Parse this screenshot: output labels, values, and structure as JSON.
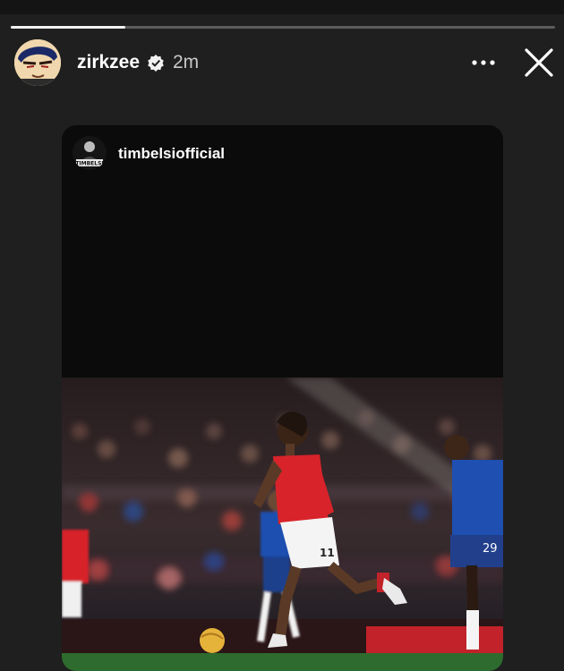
{
  "story": {
    "progress": 0.21,
    "user": {
      "username": "zirkzee",
      "verified": true,
      "time_ago": "2m",
      "avatar_icon": "anime-avatar-icon"
    },
    "actions": {
      "more_icon": "more-horizontal-icon",
      "close_icon": "close-icon"
    },
    "shared_post": {
      "username": "timbelsiofficial",
      "avatar_text": "TIMBELSI",
      "photo_jersey_number": "11"
    }
  },
  "colors": {
    "background": "#1f1f1f",
    "card": "#0b0b0b",
    "home_kit": "#d8232a",
    "away_kit": "#1f4fb0"
  }
}
